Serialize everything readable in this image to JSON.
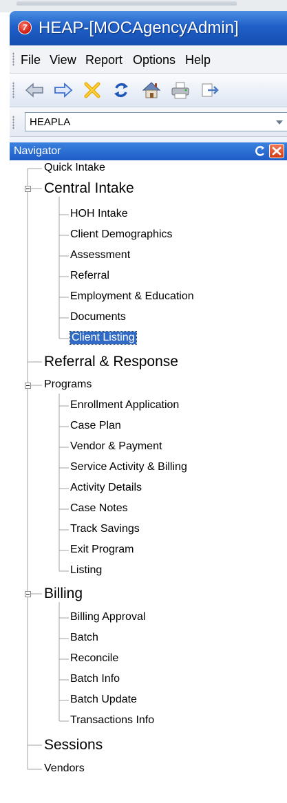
{
  "window": {
    "title": "HEAP-[MOCAgencyAdmin]",
    "app_icon": "app-logo-icon"
  },
  "menu": [
    "File",
    "View",
    "Report",
    "Options",
    "Help"
  ],
  "toolbar": {
    "buttons": [
      {
        "name": "back-arrow-icon"
      },
      {
        "name": "forward-arrow-icon"
      },
      {
        "name": "delete-x-icon"
      },
      {
        "name": "refresh-icon"
      },
      {
        "name": "home-icon"
      },
      {
        "name": "print-icon"
      },
      {
        "name": "export-icon"
      }
    ]
  },
  "agency_select": {
    "value": "HEAPLA"
  },
  "navigator": {
    "title": "Navigator",
    "tree": [
      {
        "label": "Quick Intake",
        "level": 0,
        "size": "sm"
      },
      {
        "label": "Central Intake",
        "level": 0,
        "size": "lg",
        "expanded": true
      },
      {
        "label": "HOH Intake",
        "level": 1,
        "size": "sm"
      },
      {
        "label": "Client Demographics",
        "level": 1,
        "size": "sm"
      },
      {
        "label": "Assessment",
        "level": 1,
        "size": "sm"
      },
      {
        "label": "Referral",
        "level": 1,
        "size": "sm"
      },
      {
        "label": "Employment & Education",
        "level": 1,
        "size": "sm"
      },
      {
        "label": "Documents",
        "level": 1,
        "size": "sm"
      },
      {
        "label": "Client Listing",
        "level": 1,
        "size": "sm",
        "selected": true
      },
      {
        "label": "Referral & Response",
        "level": 0,
        "size": "lg"
      },
      {
        "label": "Programs",
        "level": 0,
        "size": "sm",
        "expanded": true
      },
      {
        "label": "Enrollment Application",
        "level": 1,
        "size": "sm"
      },
      {
        "label": "Case Plan",
        "level": 1,
        "size": "sm"
      },
      {
        "label": "Vendor & Payment",
        "level": 1,
        "size": "sm"
      },
      {
        "label": "Service Activity & Billing",
        "level": 1,
        "size": "sm"
      },
      {
        "label": "Activity Details",
        "level": 1,
        "size": "sm"
      },
      {
        "label": "Case Notes",
        "level": 1,
        "size": "sm"
      },
      {
        "label": "Track Savings",
        "level": 1,
        "size": "sm"
      },
      {
        "label": "Exit Program",
        "level": 1,
        "size": "sm"
      },
      {
        "label": "Listing",
        "level": 1,
        "size": "sm"
      },
      {
        "label": "Billing",
        "level": 0,
        "size": "lg",
        "expanded": true
      },
      {
        "label": "Billing Approval",
        "level": 1,
        "size": "sm"
      },
      {
        "label": "Batch",
        "level": 1,
        "size": "sm"
      },
      {
        "label": "Reconcile",
        "level": 1,
        "size": "sm"
      },
      {
        "label": "Batch Info",
        "level": 1,
        "size": "sm"
      },
      {
        "label": "Batch Update",
        "level": 1,
        "size": "sm"
      },
      {
        "label": "Transactions Info",
        "level": 1,
        "size": "sm"
      },
      {
        "label": "Sessions",
        "level": 0,
        "size": "lg"
      },
      {
        "label": "Vendors",
        "level": 0,
        "size": "sm"
      }
    ]
  },
  "colors": {
    "title_bar": "#1f5fc7",
    "selection": "#316ac5",
    "tree_line": "#a0a0a0"
  }
}
